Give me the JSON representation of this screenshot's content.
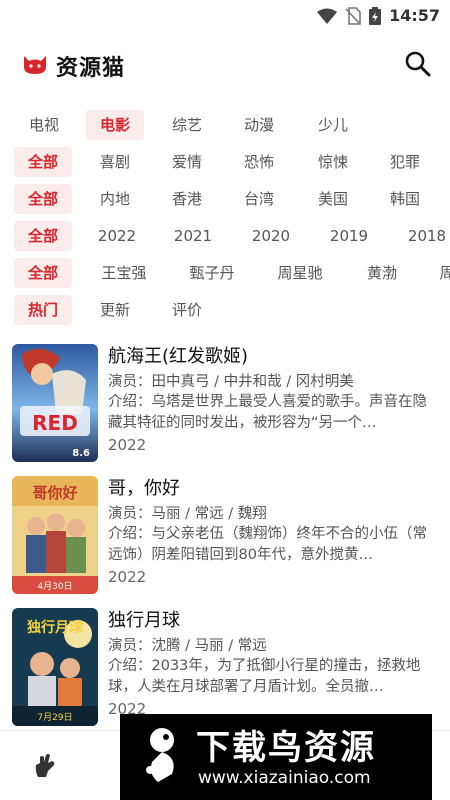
{
  "status_bar": {
    "time": "14:57"
  },
  "header": {
    "app_title": "资源猫",
    "brand_color": "#d9262c"
  },
  "filters": {
    "category": [
      "电视",
      "电影",
      "综艺",
      "动漫",
      "少儿"
    ],
    "genre": [
      "全部",
      "喜剧",
      "爱情",
      "恐怖",
      "惊悚",
      "犯罪"
    ],
    "region": [
      "全部",
      "内地",
      "香港",
      "台湾",
      "美国",
      "韩国"
    ],
    "year": [
      "全部",
      "2022",
      "2021",
      "2020",
      "2019",
      "2018"
    ],
    "actor": [
      "全部",
      "王宝强",
      "甄子丹",
      "周星驰",
      "黄渤",
      "周"
    ],
    "sort": [
      "热门",
      "更新",
      "评价"
    ],
    "active_color": "#d9262c",
    "active_bg": "#fbecec"
  },
  "movies": [
    {
      "title": "航海王(红发歌姬)",
      "cast": "演员：田中真弓 / 中井和哉 / 冈村明美",
      "intro": "介绍：乌塔是世界上最受人喜爱的歌手。声音在隐藏其特征的同时发出，被形容为“另一个…",
      "year": "2022"
    },
    {
      "title": "哥，你好",
      "cast": "演员：马丽 / 常远 / 魏翔",
      "intro": "介绍：与父亲老伍（魏翔饰）终年不合的小伍（常远饰）阴差阳错回到80年代，意外搅黄…",
      "year": "2022"
    },
    {
      "title": "独行月球",
      "cast": "演员：沈腾 / 马丽 / 常远",
      "intro": "介绍：2033年，为了抵御小行星的撞击，拯救地球，人类在月球部署了月盾计划。全员撤…",
      "year": "2022"
    }
  ],
  "posters": [
    {
      "icon": "one-piece-red-poster",
      "text": "RED",
      "badge": "8.6"
    },
    {
      "icon": "hello-brother-poster",
      "text": "哥你好",
      "caption": "4月30日"
    },
    {
      "icon": "moon-man-poster",
      "text": "独行月球",
      "caption": "7月29日"
    }
  ],
  "bottom_bar": {
    "icon": "hand-rock-icon"
  },
  "watermark": {
    "title": "下载鸟资源",
    "url": "www.xiazainiao.com"
  }
}
